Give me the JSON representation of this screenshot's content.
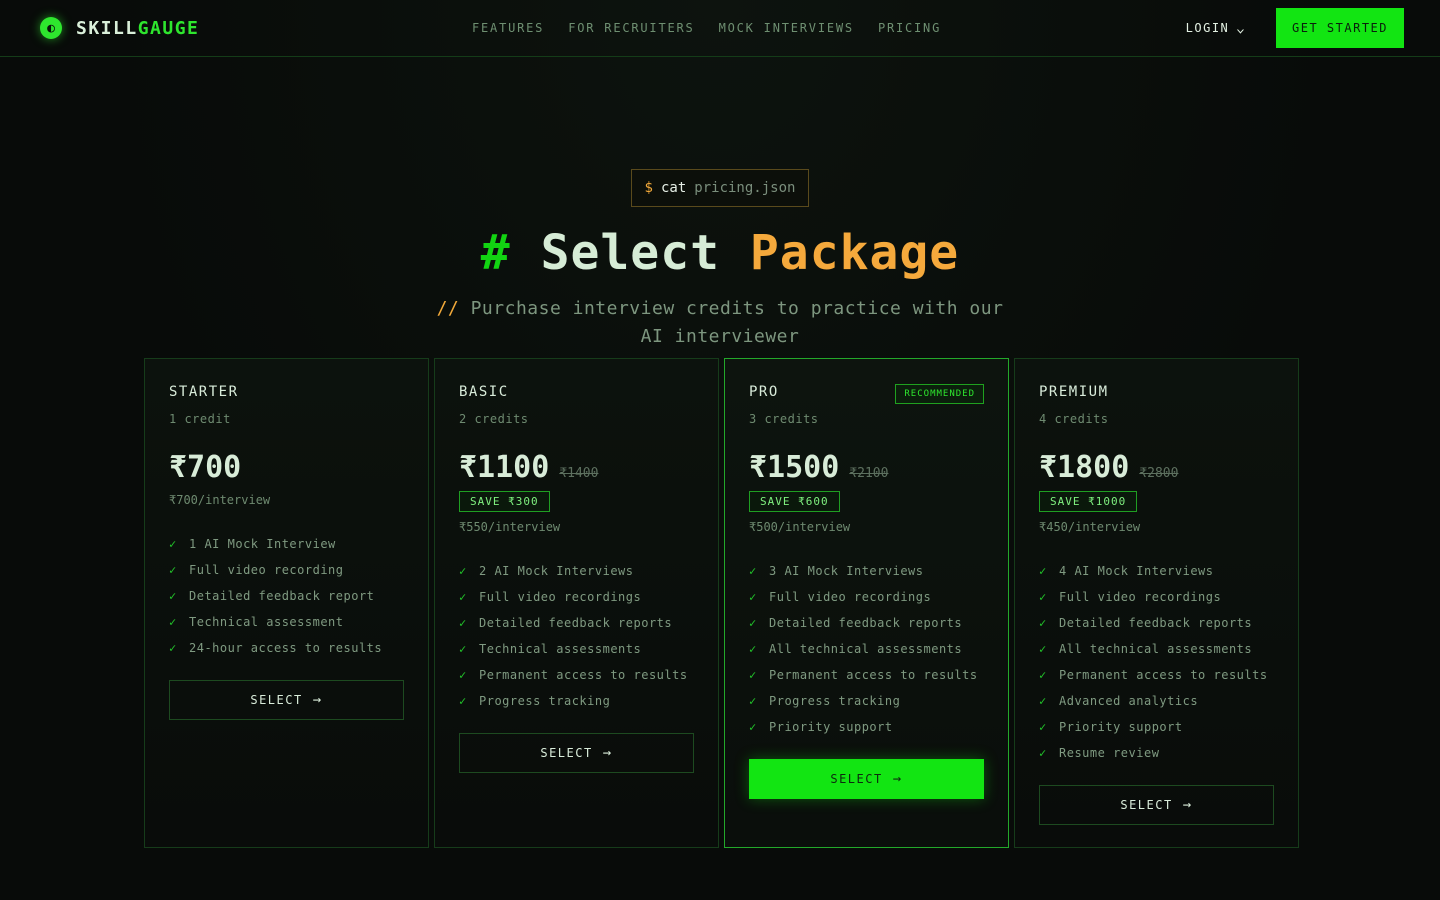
{
  "brand": {
    "name_a": "SKILL",
    "name_b": "GAUGE"
  },
  "nav": {
    "items": [
      "FEATURES",
      "FOR RECRUITERS",
      "MOCK INTERVIEWS",
      "PRICING"
    ]
  },
  "header": {
    "login_label": "LOGIN",
    "cta_label": "GET STARTED"
  },
  "hero": {
    "cmd_prompt": "$",
    "cmd_keyword": "cat",
    "cmd_arg": "pricing.json",
    "title_hash": "#",
    "title_word1": "Select",
    "title_word2": "Package",
    "subtitle_prefix": "//",
    "subtitle": "Purchase interview credits to practice with our AI interviewer"
  },
  "colors": {
    "accent": "#12e512",
    "highlight": "#f5a93c",
    "background": "#080b09"
  },
  "plans": [
    {
      "name": "STARTER",
      "credits": "1 credit",
      "price": "₹700",
      "original": "",
      "save": "",
      "per": "₹700/interview",
      "badge": "",
      "features": [
        "1 AI Mock Interview",
        "Full video recording",
        "Detailed feedback report",
        "Technical assessment",
        "24-hour access to results"
      ],
      "select_label": "SELECT"
    },
    {
      "name": "BASIC",
      "credits": "2 credits",
      "price": "₹1100",
      "original": "₹1400",
      "save": "SAVE ₹300",
      "per": "₹550/interview",
      "badge": "",
      "features": [
        "2 AI Mock Interviews",
        "Full video recordings",
        "Detailed feedback reports",
        "Technical assessments",
        "Permanent access to results",
        "Progress tracking"
      ],
      "select_label": "SELECT"
    },
    {
      "name": "PRO",
      "credits": "3 credits",
      "price": "₹1500",
      "original": "₹2100",
      "save": "SAVE ₹600",
      "per": "₹500/interview",
      "badge": "RECOMMENDED",
      "features": [
        "3 AI Mock Interviews",
        "Full video recordings",
        "Detailed feedback reports",
        "All technical assessments",
        "Permanent access to results",
        "Progress tracking",
        "Priority support"
      ],
      "select_label": "SELECT"
    },
    {
      "name": "PREMIUM",
      "credits": "4 credits",
      "price": "₹1800",
      "original": "₹2800",
      "save": "SAVE ₹1000",
      "per": "₹450/interview",
      "badge": "",
      "features": [
        "4 AI Mock Interviews",
        "Full video recordings",
        "Detailed feedback reports",
        "All technical assessments",
        "Permanent access to results",
        "Advanced analytics",
        "Priority support",
        "Resume review"
      ],
      "select_label": "SELECT"
    }
  ]
}
